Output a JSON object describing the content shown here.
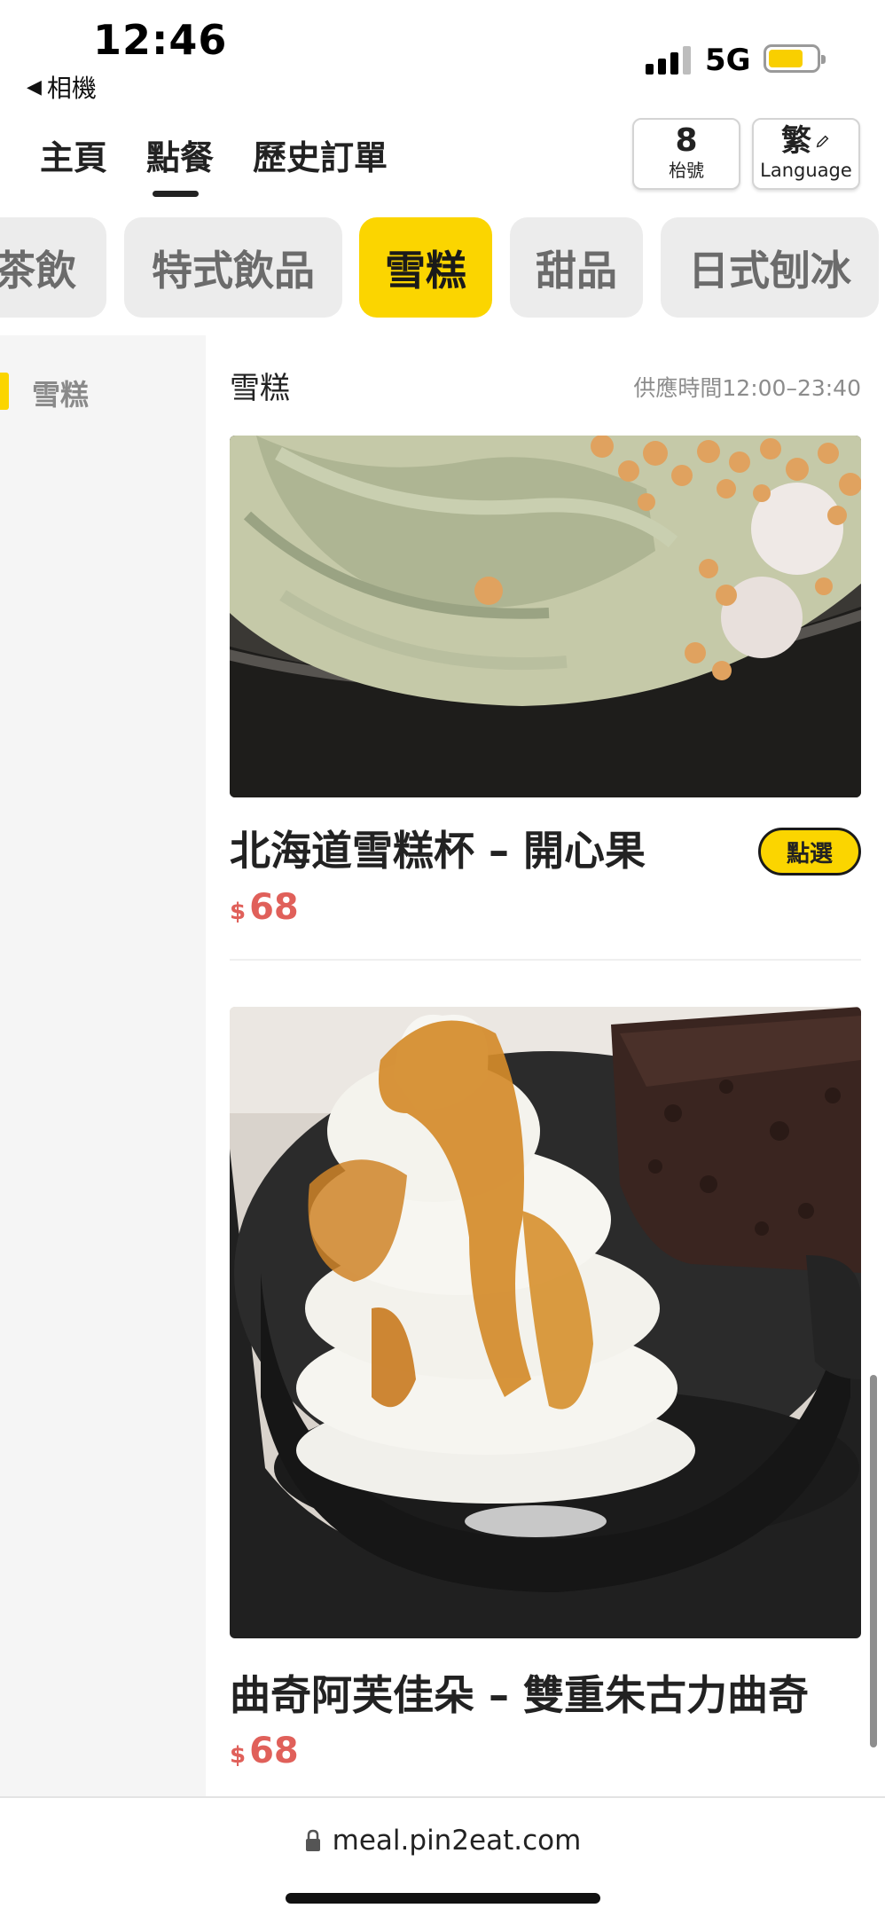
{
  "status": {
    "time": "12:46",
    "back_label": "相機",
    "network": "5G"
  },
  "nav": {
    "tabs": [
      "主頁",
      "點餐",
      "歷史訂單"
    ],
    "active_tab": "點餐",
    "table_number": "8",
    "table_label": "枱號",
    "lang_current": "繁",
    "lang_label": "Language"
  },
  "categories": [
    "茶飲",
    "特式飲品",
    "雪糕",
    "甜品",
    "日式刨冰"
  ],
  "active_category": "雪糕",
  "side": {
    "items": [
      "雪糕"
    ]
  },
  "section": {
    "title": "雪糕",
    "serving_time": "供應時間12:00–23:40"
  },
  "items": [
    {
      "name": "北海道雪糕杯 – 開心果",
      "currency": "$",
      "price": "68",
      "action": "點選"
    },
    {
      "name": "曲奇阿芙佳朵 – 雙重朱古力曲奇",
      "currency": "$",
      "price": "68"
    }
  ],
  "browser": {
    "url": "meal.pin2eat.com"
  },
  "colors": {
    "accent": "#fbd500",
    "price": "#e0605a"
  }
}
